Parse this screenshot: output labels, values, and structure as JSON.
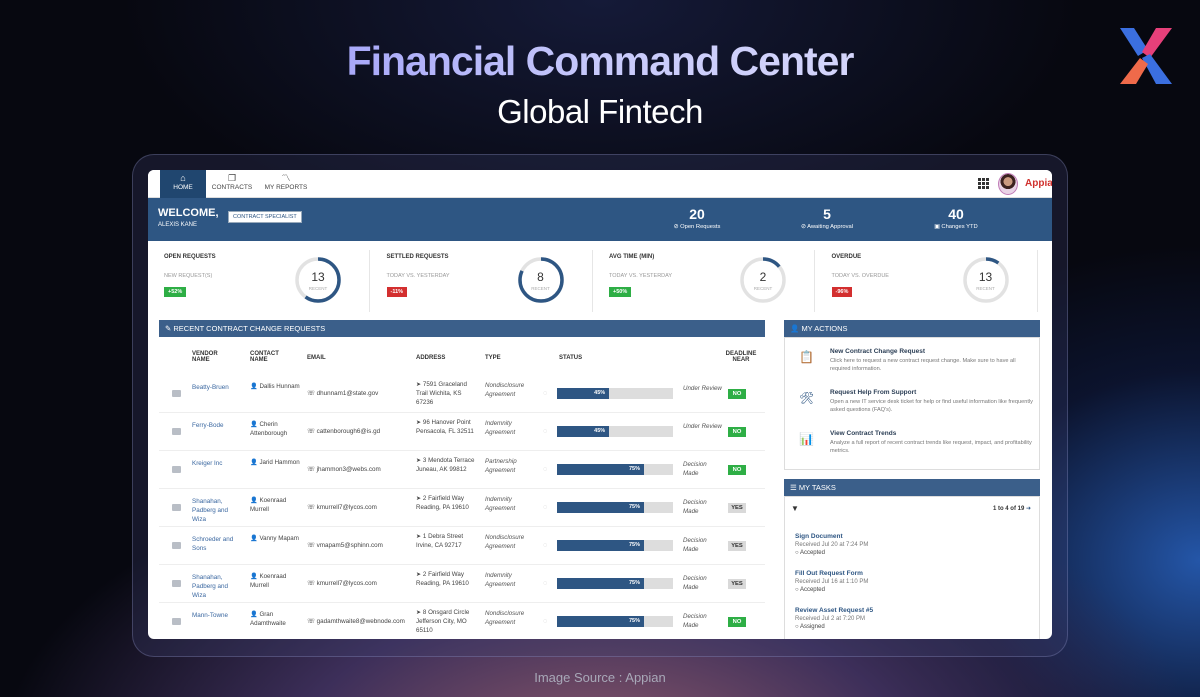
{
  "hero": {
    "title": "Financial Command Center",
    "subtitle": "Global Fintech",
    "source": "Image Source : Appian"
  },
  "nav": {
    "tabs": [
      {
        "label": "HOME",
        "icon": "home-icon"
      },
      {
        "label": "CONTRACTS",
        "icon": "contracts-icon"
      },
      {
        "label": "MY REPORTS",
        "icon": "chart-icon"
      }
    ],
    "brand": "Appian"
  },
  "welcome": {
    "title": "WELCOME,",
    "name": "ALEXIS KANE",
    "role": "CONTRACT SPECIALIST",
    "stats": [
      {
        "value": "20",
        "label": "⊘ Open Requests"
      },
      {
        "value": "5",
        "label": "⊘ Awaiting Approval"
      },
      {
        "value": "40",
        "label": "▣ Changes YTD"
      }
    ]
  },
  "kpis": [
    {
      "title": "OPEN REQUESTS",
      "sub": "NEW REQUEST(S)",
      "badge": "+52%",
      "badge_color": "#2eae45",
      "value": "13",
      "ring_label": "RECENT",
      "fill": 0.6
    },
    {
      "title": "SETTLED REQUESTS",
      "sub": "TODAY VS. YESTERDAY",
      "badge": "-11%",
      "badge_color": "#d32f2f",
      "value": "8",
      "ring_label": "RECENT",
      "fill": 0.82
    },
    {
      "title": "AVG TIME (MIN)",
      "sub": "TODAY VS. YESTERDAY",
      "badge": "+50%",
      "badge_color": "#2eae45",
      "value": "2",
      "ring_label": "RECENT",
      "fill": 0.14
    },
    {
      "title": "OVERDUE",
      "sub": "TODAY VS. OVERDUE",
      "badge": "-96%",
      "badge_color": "#d32f2f",
      "value": "13",
      "ring_label": "RECENT",
      "fill": 0.1
    }
  ],
  "recent": {
    "title": "RECENT CONTRACT CHANGE REQUESTS",
    "headers": {
      "vendor": "VENDOR NAME",
      "contact": "CONTACT NAME",
      "email": "EMAIL",
      "address": "ADDRESS",
      "type": "TYPE",
      "status": "STATUS",
      "deadline": "DEADLINE NEAR"
    },
    "rows": [
      {
        "vendor": "Beatty-Bruen",
        "contact": "Dallis Hunnam",
        "email": "dhunnam1@state.gov",
        "address": "7591 Graceland Trail Wichita, KS 67236",
        "type": "Nondisclosure Agreement",
        "pct": "45%",
        "progress": 45,
        "state": "Under Review",
        "deadline": "NO"
      },
      {
        "vendor": "Ferry-Bode",
        "contact": "Cherin Attenborough",
        "email": "cattenborough6@is.gd",
        "address": "96 Hanover Point Pensacola, FL 32511",
        "type": "Indemnity Agreement",
        "pct": "45%",
        "progress": 45,
        "state": "Under Review",
        "deadline": "NO"
      },
      {
        "vendor": "Kreiger Inc",
        "contact": "Jarid Hammon",
        "email": "jhammon3@webs.com",
        "address": "3 Mendota Terrace Juneau, AK 99812",
        "type": "Partnership Agreement",
        "pct": "75%",
        "progress": 75,
        "state": "Decision Made",
        "deadline": "NO"
      },
      {
        "vendor": "Shanahan, Padberg and Wiza",
        "contact": "Koenraad Murrell",
        "email": "kmurrell7@lycos.com",
        "address": "2 Fairfield Way Reading, PA 19610",
        "type": "Indemnity Agreement",
        "pct": "75%",
        "progress": 75,
        "state": "Decision Made",
        "deadline": "YES"
      },
      {
        "vendor": "Schroeder and Sons",
        "contact": "Vanny Mapam",
        "email": "vmapam5@sphinn.com",
        "address": "1 Debra Street Irvine, CA 92717",
        "type": "Nondisclosure Agreement",
        "pct": "75%",
        "progress": 75,
        "state": "Decision Made",
        "deadline": "YES"
      },
      {
        "vendor": "Shanahan, Padberg and Wiza",
        "contact": "Koenraad Murrell",
        "email": "kmurrell7@lycos.com",
        "address": "2 Fairfield Way Reading, PA 19610",
        "type": "Indemnity Agreement",
        "pct": "75%",
        "progress": 75,
        "state": "Decision Made",
        "deadline": "YES"
      },
      {
        "vendor": "Mann-Towne",
        "contact": "Gran Adamthwaite",
        "email": "gadamthwaite8@webnode.com",
        "address": "8 Onsgard Circle Jefferson City, MO 65110",
        "type": "Nondisclosure Agreement",
        "pct": "75%",
        "progress": 75,
        "state": "Decision Made",
        "deadline": "NO"
      }
    ]
  },
  "actions": {
    "title": "MY ACTIONS",
    "items": [
      {
        "title": "New Contract Change Request",
        "desc": "Click here to request a new contract request change. Make sure to have all required information.",
        "icon": "clipboard-icon"
      },
      {
        "title": "Request Help From Support",
        "desc": "Open a new IT service desk ticket for help or find useful information like frequently asked questions (FAQ's).",
        "icon": "support-icon"
      },
      {
        "title": "View Contract Trends",
        "desc": "Analyze a full report of recent contract trends like request, impact, and profitability metrics.",
        "icon": "trends-icon"
      }
    ]
  },
  "tasks": {
    "title": "MY TASKS",
    "pager": "1 to 4 of 19",
    "items": [
      {
        "title": "Sign Document",
        "received": "Received Jul 20 at 7:24 PM",
        "status": "Accepted"
      },
      {
        "title": "Fill Out Request Form",
        "received": "Received Jul 16 at 1:10 PM",
        "status": "Accepted"
      },
      {
        "title": "Review Asset Request #5",
        "received": "Received Jul 2 at 7:20 PM",
        "status": "Assigned"
      }
    ]
  }
}
